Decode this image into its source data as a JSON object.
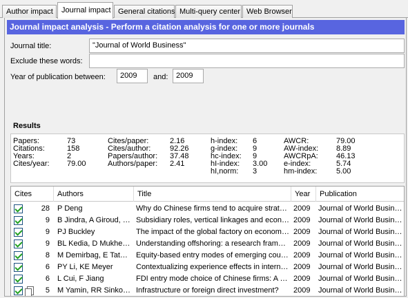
{
  "tabs": [
    "Author impact",
    "Journal impact",
    "General citations",
    "Multi-query center",
    "Web Browser"
  ],
  "header": "Journal impact analysis - Perform a citation analysis for one or more journals",
  "form": {
    "journal_title_label": "Journal title:",
    "journal_title_value": "\"Journal of World Business\"",
    "exclude_label": "Exclude these words:",
    "exclude_value": "",
    "year_label": "Year of publication between:",
    "year_from": "2009",
    "and_label": "and:",
    "year_to": "2009"
  },
  "results_title": "Results",
  "stats": [
    {
      "label": "Papers:",
      "value": "73"
    },
    {
      "label": "Citations:",
      "value": "158"
    },
    {
      "label": "Years:",
      "value": "2"
    },
    {
      "label": "Cites/year:",
      "value": "79.00"
    },
    {
      "label": "Cites/paper:",
      "value": "2.16"
    },
    {
      "label": "Cites/author:",
      "value": "92.26"
    },
    {
      "label": "Papers/author:",
      "value": "37.48"
    },
    {
      "label": "Authors/paper:",
      "value": "2.41"
    },
    {
      "label": "h-index:",
      "value": "6"
    },
    {
      "label": "g-index:",
      "value": "9"
    },
    {
      "label": "hc-index:",
      "value": "9"
    },
    {
      "label": "hI-index:",
      "value": "3.00"
    },
    {
      "label": "hI,norm:",
      "value": "3"
    },
    {
      "label": "AWCR:",
      "value": "79.00"
    },
    {
      "label": "AW-index:",
      "value": "8.89"
    },
    {
      "label": "AWCRpA:",
      "value": "46.13"
    },
    {
      "label": "e-index:",
      "value": "5.74"
    },
    {
      "label": "hm-index:",
      "value": "5.00"
    }
  ],
  "columns": [
    "Cites",
    "Authors",
    "Title",
    "Year",
    "Publication"
  ],
  "rows": [
    {
      "cites": "28",
      "authors": "P Deng",
      "title": "Why do Chinese firms tend to acquire strategic assets in international expansion?",
      "year": "2009",
      "publication": "Journal of World Business"
    },
    {
      "cites": "9",
      "authors": "B Jindra, A Giroud, J Scott-Kennel",
      "title": "Subsidiary roles, vertical linkages and economic development",
      "year": "2009",
      "publication": "Journal of World Business"
    },
    {
      "cites": "9",
      "authors": "PJ Buckley",
      "title": "The impact of the global factory on economic development",
      "year": "2009",
      "publication": "Journal of World Business"
    },
    {
      "cites": "9",
      "authors": "BL Kedia, D Mukherjee",
      "title": "Understanding offshoring: a research framework",
      "year": "2009",
      "publication": "Journal of World Business"
    },
    {
      "cites": "8",
      "authors": "M Demirbag, E Tatoglu, KW Glaister",
      "title": "Equity-based entry modes of emerging country multinationals",
      "year": "2009",
      "publication": "Journal of World Business"
    },
    {
      "cites": "6",
      "authors": "PY Li, KE Meyer",
      "title": "Contextualizing experience effects in international business",
      "year": "2009",
      "publication": "Journal of World Business"
    },
    {
      "cites": "6",
      "authors": "L Cui, F Jiang",
      "title": "FDI entry mode choice of Chinese firms: A strategic behavior perspective",
      "year": "2009",
      "publication": "Journal of World Business"
    },
    {
      "cites": "5",
      "authors": "M Yamin, RR Sinkovics",
      "title": "Infrastructure or foreign direct investment?",
      "year": "2009",
      "publication": "Journal of World Business"
    }
  ]
}
